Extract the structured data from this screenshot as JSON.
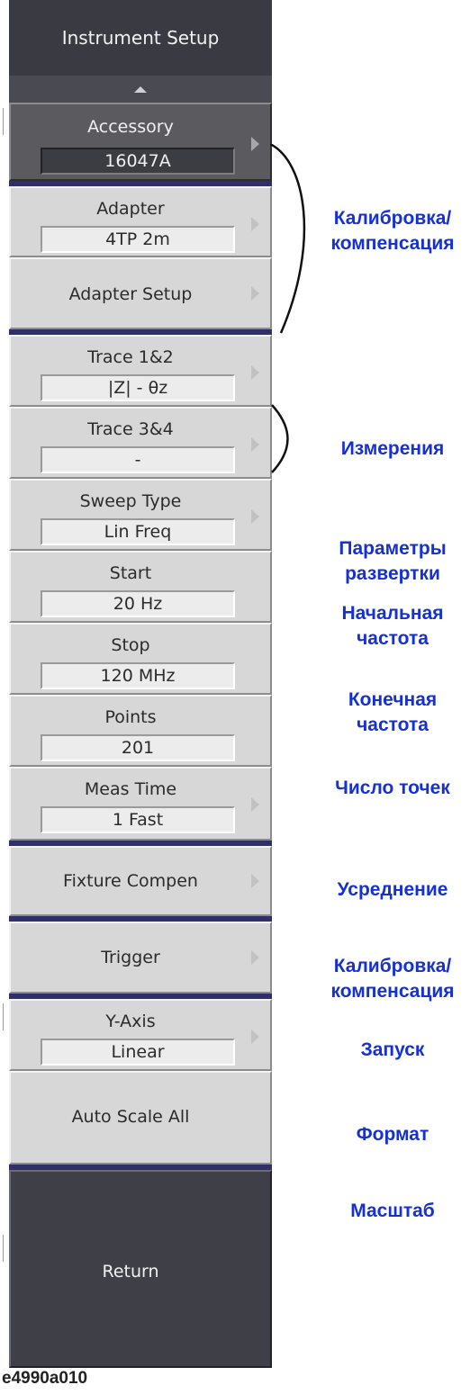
{
  "menu": {
    "title": "Instrument Setup",
    "buttons": [
      {
        "id": "accessory",
        "label": "Accessory",
        "value": "16047A",
        "has_arrow": true,
        "style": "dark"
      },
      {
        "id": "adapter",
        "label": "Adapter",
        "value": "4TP 2m",
        "has_arrow": true,
        "style": "normal"
      },
      {
        "id": "adapter-setup",
        "label": "Adapter Setup",
        "has_arrow": true,
        "style": "normal"
      },
      {
        "id": "trace-1-2",
        "label": "Trace 1&2",
        "value": "|Z| - θz",
        "has_arrow": true,
        "style": "normal"
      },
      {
        "id": "trace-3-4",
        "label": "Trace 3&4",
        "value": "-",
        "has_arrow": true,
        "style": "normal"
      },
      {
        "id": "sweep-type",
        "label": "Sweep Type",
        "value": "Lin Freq",
        "has_arrow": true,
        "style": "normal"
      },
      {
        "id": "start",
        "label": "Start",
        "value": "20 Hz",
        "has_arrow": false,
        "style": "normal"
      },
      {
        "id": "stop",
        "label": "Stop",
        "value": "120 MHz",
        "has_arrow": false,
        "style": "normal"
      },
      {
        "id": "points",
        "label": "Points",
        "value": "201",
        "has_arrow": false,
        "style": "normal"
      },
      {
        "id": "meas-time",
        "label": "Meas Time",
        "value": "1 Fast",
        "has_arrow": true,
        "style": "normal"
      },
      {
        "id": "fixture-compen",
        "label": "Fixture Compen",
        "has_arrow": true,
        "style": "normal"
      },
      {
        "id": "trigger",
        "label": "Trigger",
        "has_arrow": true,
        "style": "normal"
      },
      {
        "id": "y-axis",
        "label": "Y-Axis",
        "value": "Linear",
        "has_arrow": true,
        "style": "normal"
      },
      {
        "id": "auto-scale-all",
        "label": "Auto Scale All",
        "has_arrow": false,
        "style": "normal"
      },
      {
        "id": "return",
        "label": "Return",
        "has_arrow": false,
        "style": "return"
      }
    ]
  },
  "annotations": {
    "calibration_1": "Калибровка/ компенсация",
    "measurements": "Измерения",
    "sweep_params": "Параметры развертки",
    "start_freq": "Начальная частота",
    "stop_freq": "Конечная частота",
    "points_count": "Число точек",
    "averaging": "Усреднение",
    "calibration_2": "Калибровка/ компенсация",
    "trigger": "Запуск",
    "format": "Формат",
    "scale": "Масштаб"
  },
  "caption": "e4990a010",
  "colors": {
    "annotation": "#1530d6",
    "separator": "#2f2f6a",
    "panel": "#2b2c33"
  }
}
